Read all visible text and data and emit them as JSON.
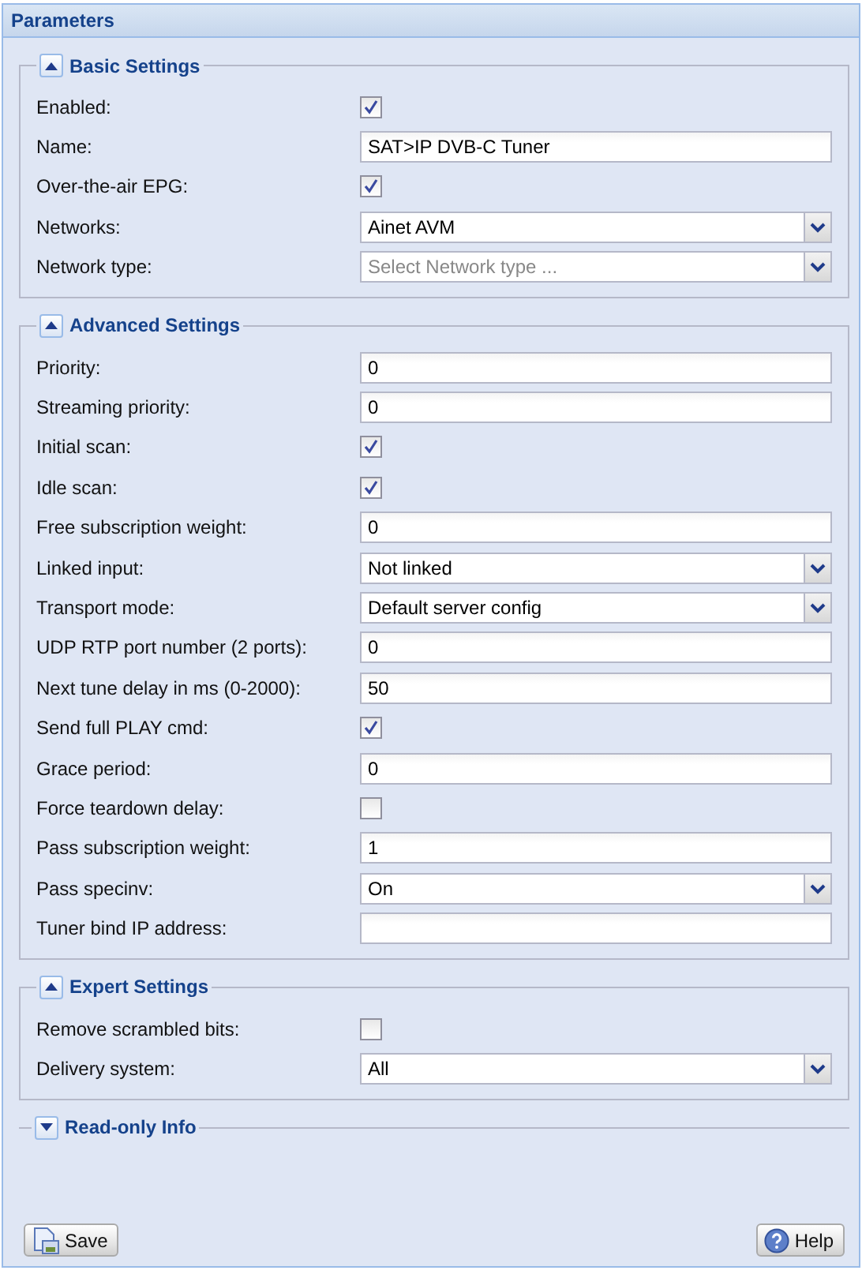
{
  "panel": {
    "title": "Parameters"
  },
  "sections": [
    {
      "title": "Basic Settings",
      "expanded": true,
      "fields": [
        {
          "label": "Enabled:",
          "kind": "checkbox",
          "checked": true
        },
        {
          "label": "Name:",
          "kind": "text",
          "value": "SAT>IP DVB-C Tuner"
        },
        {
          "label": "Over-the-air EPG:",
          "kind": "checkbox",
          "checked": true
        },
        {
          "label": "Networks:",
          "kind": "select",
          "value": "Ainet AVM"
        },
        {
          "label": "Network type:",
          "kind": "select",
          "placeholder": "Select Network type ..."
        }
      ]
    },
    {
      "title": "Advanced Settings",
      "expanded": true,
      "fields": [
        {
          "label": "Priority:",
          "kind": "text",
          "value": "0"
        },
        {
          "label": "Streaming priority:",
          "kind": "text",
          "value": "0"
        },
        {
          "label": "Initial scan:",
          "kind": "checkbox",
          "checked": true
        },
        {
          "label": "Idle scan:",
          "kind": "checkbox",
          "checked": true
        },
        {
          "label": "Free subscription weight:",
          "kind": "text",
          "value": "0"
        },
        {
          "label": "Linked input:",
          "kind": "select",
          "value": "Not linked"
        },
        {
          "label": "Transport mode:",
          "kind": "select",
          "value": "Default server config"
        },
        {
          "label": "UDP RTP port number (2 ports):",
          "kind": "text",
          "value": "0"
        },
        {
          "label": "Next tune delay in ms (0-2000):",
          "kind": "text",
          "value": "50"
        },
        {
          "label": "Send full PLAY cmd:",
          "kind": "checkbox",
          "checked": true
        },
        {
          "label": "Grace period:",
          "kind": "text",
          "value": "0"
        },
        {
          "label": "Force teardown delay:",
          "kind": "checkbox",
          "checked": false
        },
        {
          "label": "Pass subscription weight:",
          "kind": "text",
          "value": "1"
        },
        {
          "label": "Pass specinv:",
          "kind": "select",
          "value": "On"
        },
        {
          "label": "Tuner bind IP address:",
          "kind": "text"
        }
      ]
    },
    {
      "title": "Expert Settings",
      "expanded": true,
      "fields": [
        {
          "label": "Remove scrambled bits:",
          "kind": "checkbox",
          "checked": false
        },
        {
          "label": "Delivery system:",
          "kind": "select",
          "value": "All"
        }
      ]
    },
    {
      "title": "Read-only Info",
      "expanded": false
    }
  ],
  "buttons": [
    {
      "label": "Save",
      "kind": "save"
    },
    {
      "label": "Help",
      "kind": "help"
    }
  ]
}
